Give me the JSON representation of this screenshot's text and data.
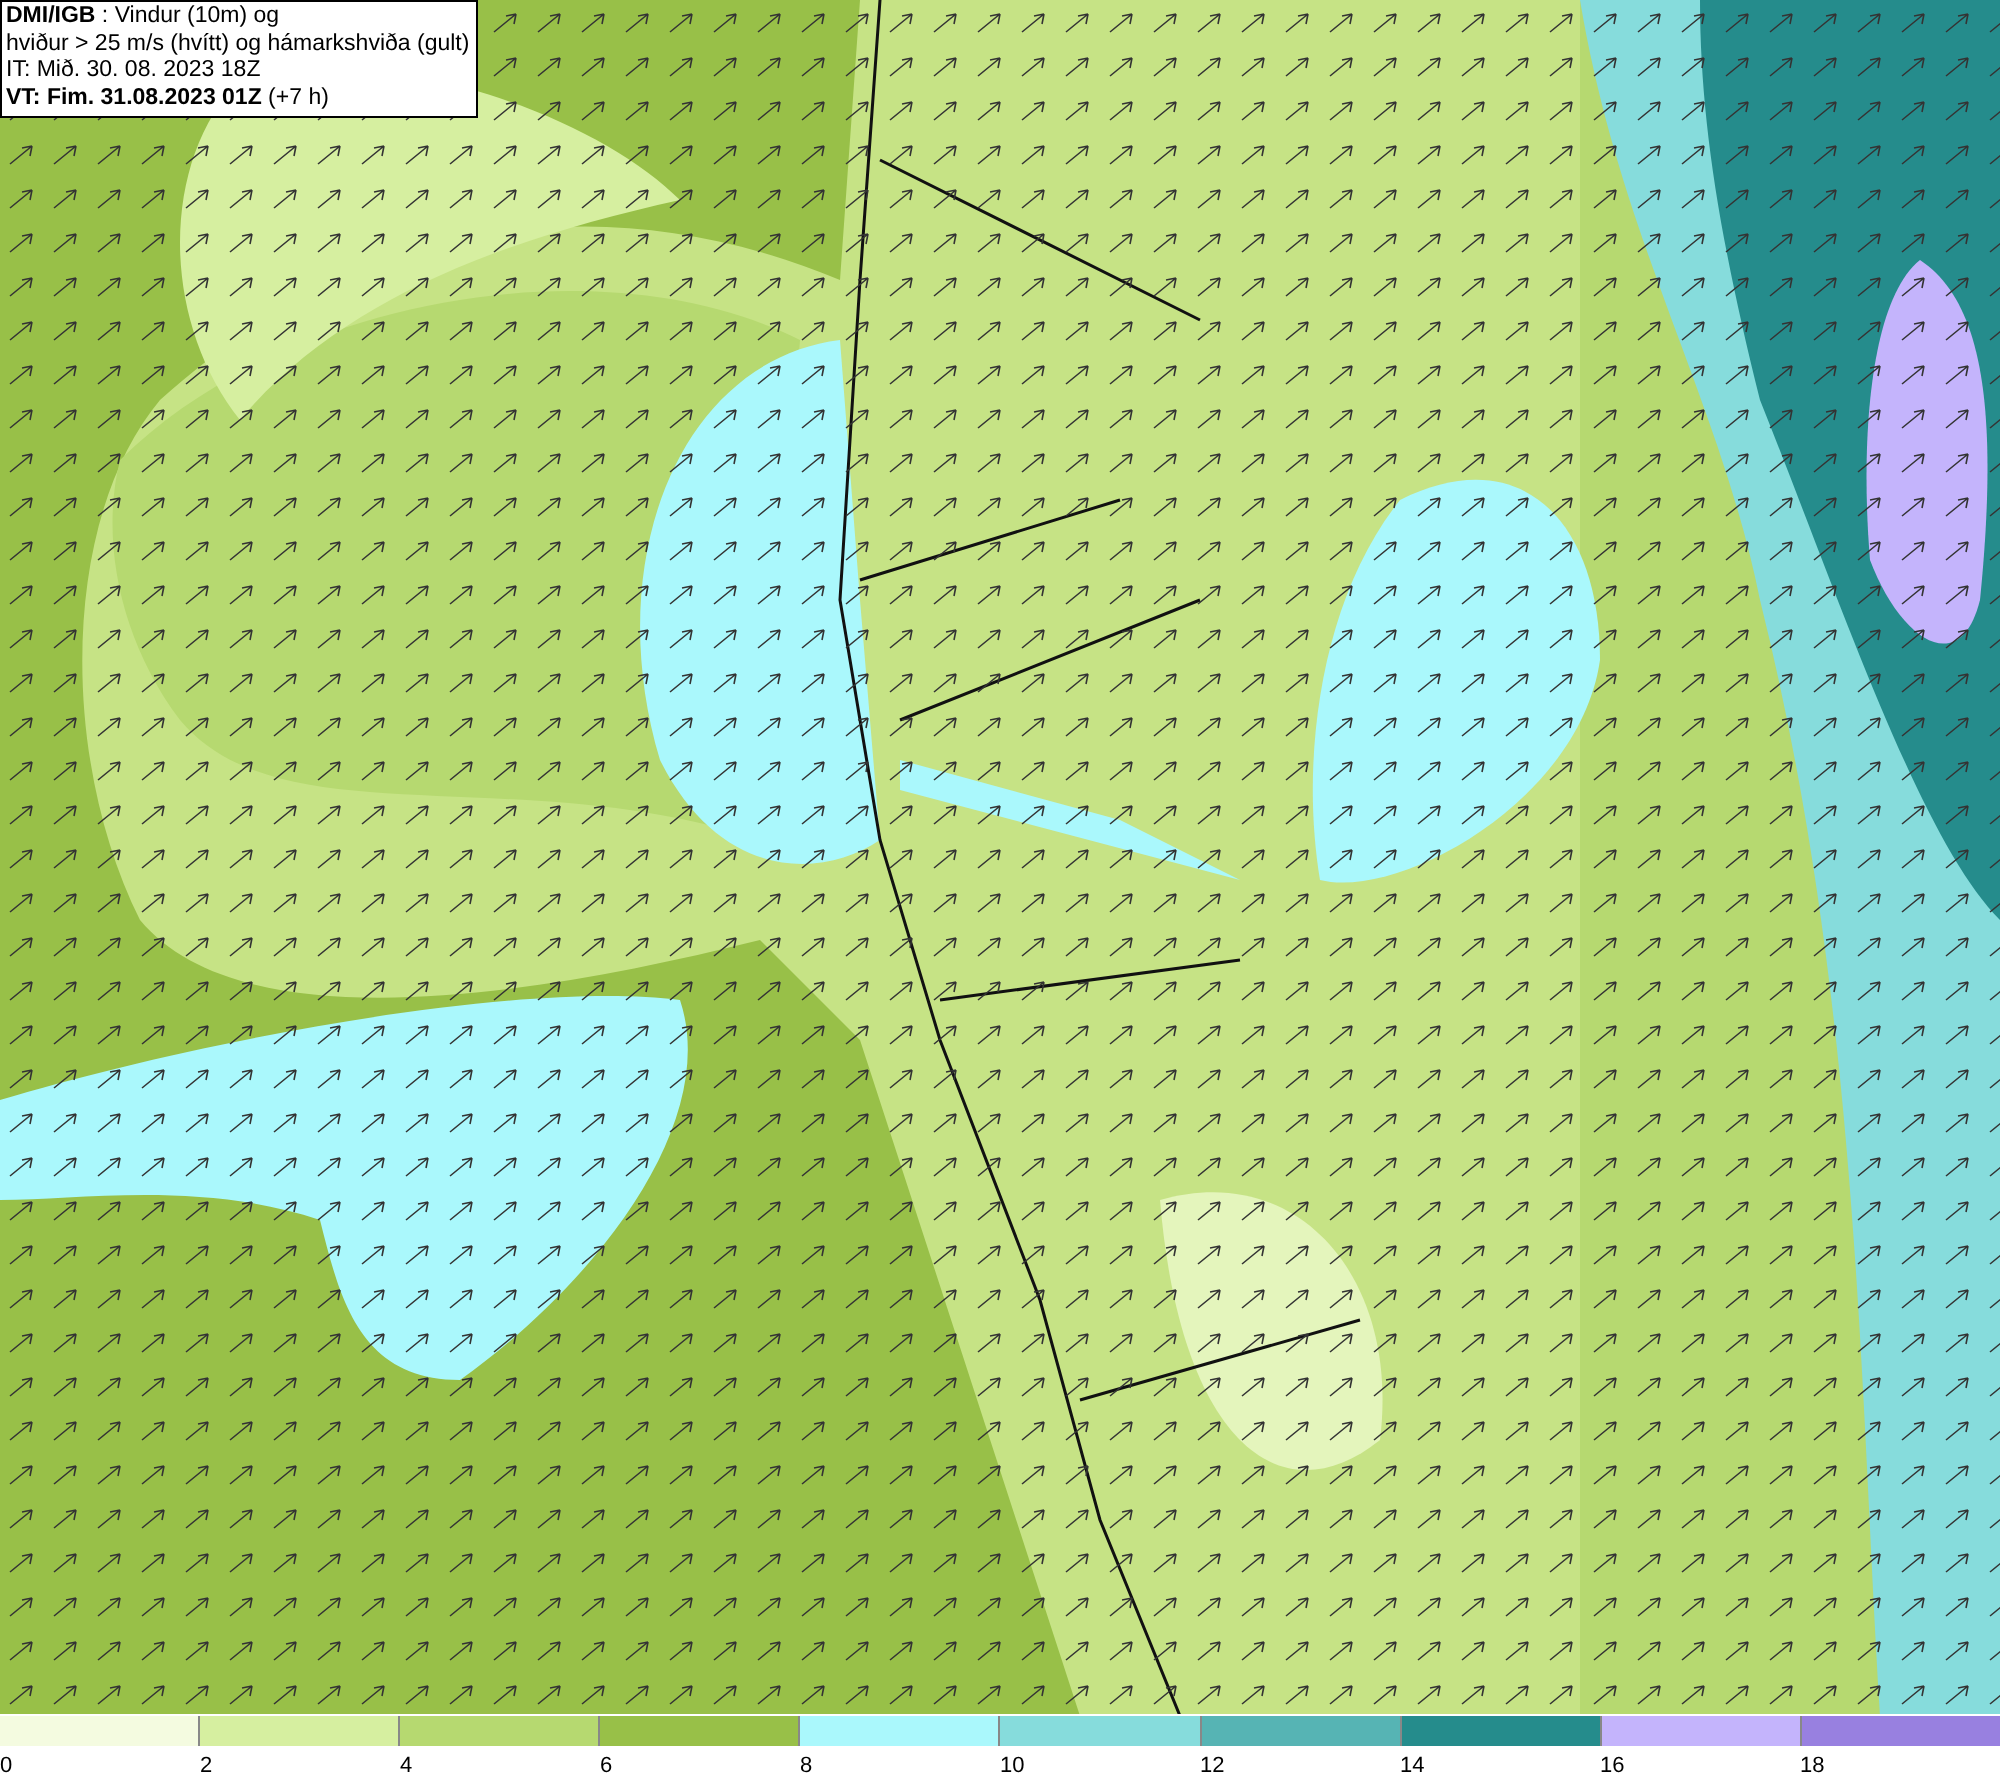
{
  "title_box": {
    "lines": [
      "**DMI/IGB** : Vindur (10m) og",
      "hviður > 25 m/s (hvítt) og hámarkshviða (gult)",
      "IT: Mið. 30. 08. 2023 18Z",
      "**VT: Fim. 31.08.2023 01Z** (+7 h)"
    ]
  },
  "legend": {
    "bins": [
      {
        "color": "#f4fbe0"
      },
      {
        "color": "#d6efa0"
      },
      {
        "color": "#b6d970"
      },
      {
        "color": "#98c048"
      },
      {
        "color": "#aaf8fc"
      },
      {
        "color": "#86dcdc"
      },
      {
        "color": "#56b4b4"
      },
      {
        "color": "#258c8c"
      },
      {
        "color": "#c4b4fc"
      },
      {
        "color": "#9880e0"
      }
    ],
    "labels": [
      "0",
      "2",
      "4",
      "6",
      "8",
      "10",
      "12",
      "14",
      "16",
      "18"
    ]
  }
}
